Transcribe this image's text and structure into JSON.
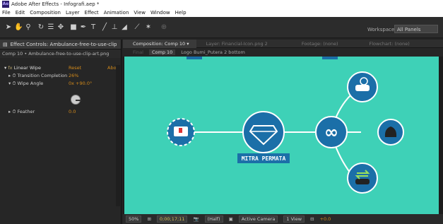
{
  "window": {
    "title": "Adobe After Effects - Infografi.aep *",
    "app_badge": "Ae"
  },
  "menu": [
    "File",
    "Edit",
    "Composition",
    "Layer",
    "Effect",
    "Animation",
    "View",
    "Window",
    "Help"
  ],
  "toolbar": {
    "workspace_label": "Workspace:",
    "workspace_value": "All Panels"
  },
  "effect_controls": {
    "tab_label": "Effect Controls: Ambulance-free-to-use-clip",
    "subtitle": "Comp 10 • Ambulance-free-to-use-clip-art.png",
    "effect_name": "Linear Wipe",
    "reset_label": "Reset",
    "about_label": "Abo",
    "params": [
      {
        "name": "Transition Completion",
        "value": "26%"
      },
      {
        "name": "Wipe Angle",
        "value": "0x +90.0°"
      },
      {
        "name": "Feather",
        "value": "0.0"
      }
    ]
  },
  "comp_panel": {
    "tabs": [
      {
        "label": "Composition: Comp 10",
        "active": true
      },
      {
        "label": "Layer: Financial-Icon.png 2",
        "active": false
      },
      {
        "label": "Footage: (none)",
        "active": false
      },
      {
        "label": "Flowchart: (none)",
        "active": false
      }
    ],
    "breadcrumbs": [
      "Final",
      "Comp 10",
      "Logo Bumi_Putera 2 bottom"
    ],
    "center_label": "MITRA PERMATA"
  },
  "status_bar": {
    "zoom": "50%",
    "timecode": "0;00;17;11",
    "resolution": "(Half)",
    "camera": "Active Camera",
    "view": "1 View",
    "exposure": "+0.0"
  },
  "colors": {
    "viewer_bg": "#3ed1b7",
    "node_fill": "#1b6fa8",
    "node_ring": "#ffffff",
    "label_bg": "#1b6fa8",
    "accent_orange": "#d38a1a"
  }
}
